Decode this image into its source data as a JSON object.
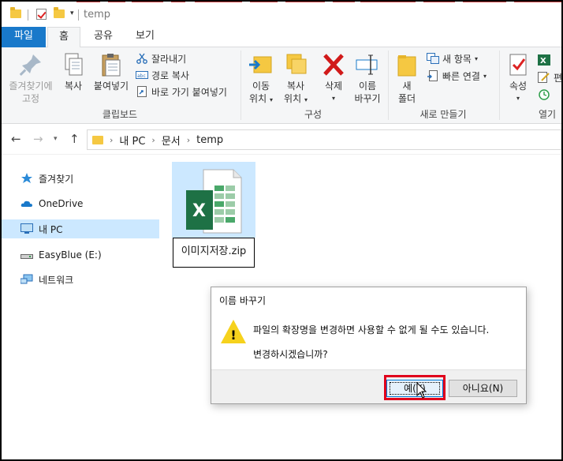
{
  "window": {
    "title": "temp"
  },
  "ribbon_tabs": [
    {
      "label": "파일"
    },
    {
      "label": "홈"
    },
    {
      "label": "공유"
    },
    {
      "label": "보기"
    }
  ],
  "ribbon": {
    "clipboard": {
      "group_label": "클립보드",
      "pin_label_1": "즐겨찾기에",
      "pin_label_2": "고정",
      "copy_label": "복사",
      "paste_label": "붙여넣기",
      "cut_label": "잘라내기",
      "copy_path_label": "경로 복사",
      "paste_shortcut_label": "바로 가기 붙여넣기"
    },
    "organize": {
      "group_label": "구성",
      "move_1": "이동",
      "move_2": "위치",
      "copyto_1": "복사",
      "copyto_2": "위치",
      "delete_label": "삭제",
      "rename_1": "이름",
      "rename_2": "바꾸기"
    },
    "new": {
      "group_label": "새로 만들기",
      "folder_1": "새",
      "folder_2": "폴더",
      "new_item": "새 항목",
      "easy_access": "빠른 연결"
    },
    "open": {
      "group_label": "열기",
      "properties": "속성",
      "edit_partial": "편"
    }
  },
  "address": {
    "crumbs": [
      "내 PC",
      "문서",
      "temp"
    ]
  },
  "nav_pane": {
    "items": [
      {
        "label": "즐겨찾기"
      },
      {
        "label": "OneDrive"
      },
      {
        "label": "내 PC"
      },
      {
        "label": "EasyBlue (E:)"
      },
      {
        "label": "네트워크"
      }
    ]
  },
  "content": {
    "file": {
      "name": "이미지저장.zip"
    }
  },
  "dialog": {
    "title": "이름 바꾸기",
    "message_1": "파일의 확장명을 변경하면 사용할 수 없게 될 수도 있습니다.",
    "message_2": "변경하시겠습니까?",
    "yes_label": "예(Y)",
    "no_label": "아니요(N)"
  },
  "colors": {
    "accent": "#1979ca",
    "selection": "#cce8ff",
    "highlight": "#e0001b",
    "excel_green": "#1e7145"
  }
}
